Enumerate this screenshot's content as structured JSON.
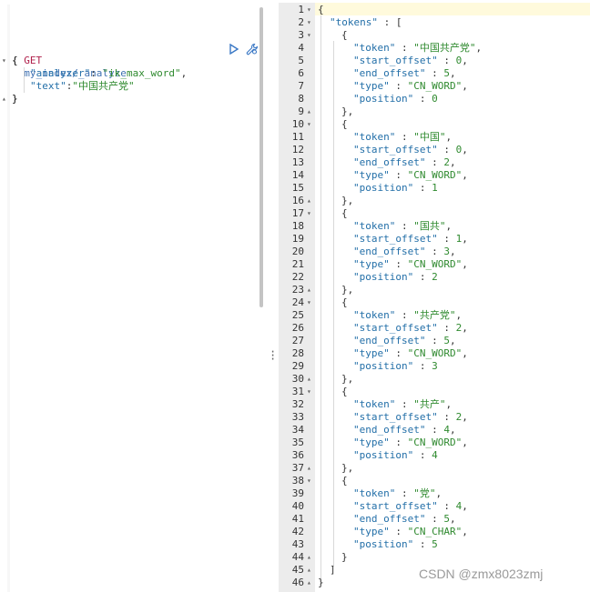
{
  "request": {
    "method": "GET",
    "path": "my_index/_analyze",
    "body": [
      {
        "fold": "▾",
        "text": "{"
      },
      {
        "fold": "",
        "parts": [
          {
            "t": "\"analyzer\"",
            "c": "key"
          },
          {
            "t": ": ",
            "c": "punc"
          },
          {
            "t": "\"ik_max_word\"",
            "c": "str"
          },
          {
            "t": ",",
            "c": "punc"
          }
        ]
      },
      {
        "fold": "",
        "parts": [
          {
            "t": "\"text\"",
            "c": "key"
          },
          {
            "t": ":",
            "c": "punc"
          },
          {
            "t": "\"中国共产党\"",
            "c": "str"
          }
        ]
      },
      {
        "fold": "▴",
        "text": "}"
      }
    ]
  },
  "response": {
    "lines": [
      {
        "n": "1",
        "f": "▾",
        "ind": 0,
        "parts": [
          {
            "t": "{",
            "c": "punc"
          }
        ]
      },
      {
        "n": "2",
        "f": "▾",
        "ind": 1,
        "parts": [
          {
            "t": "\"tokens\"",
            "c": "key"
          },
          {
            "t": " : [",
            "c": "punc"
          }
        ]
      },
      {
        "n": "3",
        "f": "▾",
        "ind": 2,
        "parts": [
          {
            "t": "{",
            "c": "punc"
          }
        ]
      },
      {
        "n": "4",
        "f": "",
        "ind": 3,
        "parts": [
          {
            "t": "\"token\"",
            "c": "key"
          },
          {
            "t": " : ",
            "c": "punc"
          },
          {
            "t": "\"中国共产党\"",
            "c": "str"
          },
          {
            "t": ",",
            "c": "punc"
          }
        ]
      },
      {
        "n": "5",
        "f": "",
        "ind": 3,
        "parts": [
          {
            "t": "\"start_offset\"",
            "c": "key"
          },
          {
            "t": " : ",
            "c": "punc"
          },
          {
            "t": "0",
            "c": "num"
          },
          {
            "t": ",",
            "c": "punc"
          }
        ]
      },
      {
        "n": "6",
        "f": "",
        "ind": 3,
        "parts": [
          {
            "t": "\"end_offset\"",
            "c": "key"
          },
          {
            "t": " : ",
            "c": "punc"
          },
          {
            "t": "5",
            "c": "num"
          },
          {
            "t": ",",
            "c": "punc"
          }
        ]
      },
      {
        "n": "7",
        "f": "",
        "ind": 3,
        "parts": [
          {
            "t": "\"type\"",
            "c": "key"
          },
          {
            "t": " : ",
            "c": "punc"
          },
          {
            "t": "\"CN_WORD\"",
            "c": "str"
          },
          {
            "t": ",",
            "c": "punc"
          }
        ]
      },
      {
        "n": "8",
        "f": "",
        "ind": 3,
        "parts": [
          {
            "t": "\"position\"",
            "c": "key"
          },
          {
            "t": " : ",
            "c": "punc"
          },
          {
            "t": "0",
            "c": "num"
          }
        ]
      },
      {
        "n": "9",
        "f": "▴",
        "ind": 2,
        "parts": [
          {
            "t": "},",
            "c": "punc"
          }
        ]
      },
      {
        "n": "10",
        "f": "▾",
        "ind": 2,
        "parts": [
          {
            "t": "{",
            "c": "punc"
          }
        ]
      },
      {
        "n": "11",
        "f": "",
        "ind": 3,
        "parts": [
          {
            "t": "\"token\"",
            "c": "key"
          },
          {
            "t": " : ",
            "c": "punc"
          },
          {
            "t": "\"中国\"",
            "c": "str"
          },
          {
            "t": ",",
            "c": "punc"
          }
        ]
      },
      {
        "n": "12",
        "f": "",
        "ind": 3,
        "parts": [
          {
            "t": "\"start_offset\"",
            "c": "key"
          },
          {
            "t": " : ",
            "c": "punc"
          },
          {
            "t": "0",
            "c": "num"
          },
          {
            "t": ",",
            "c": "punc"
          }
        ]
      },
      {
        "n": "13",
        "f": "",
        "ind": 3,
        "parts": [
          {
            "t": "\"end_offset\"",
            "c": "key"
          },
          {
            "t": " : ",
            "c": "punc"
          },
          {
            "t": "2",
            "c": "num"
          },
          {
            "t": ",",
            "c": "punc"
          }
        ]
      },
      {
        "n": "14",
        "f": "",
        "ind": 3,
        "parts": [
          {
            "t": "\"type\"",
            "c": "key"
          },
          {
            "t": " : ",
            "c": "punc"
          },
          {
            "t": "\"CN_WORD\"",
            "c": "str"
          },
          {
            "t": ",",
            "c": "punc"
          }
        ]
      },
      {
        "n": "15",
        "f": "",
        "ind": 3,
        "parts": [
          {
            "t": "\"position\"",
            "c": "key"
          },
          {
            "t": " : ",
            "c": "punc"
          },
          {
            "t": "1",
            "c": "num"
          }
        ]
      },
      {
        "n": "16",
        "f": "▴",
        "ind": 2,
        "parts": [
          {
            "t": "},",
            "c": "punc"
          }
        ]
      },
      {
        "n": "17",
        "f": "▾",
        "ind": 2,
        "parts": [
          {
            "t": "{",
            "c": "punc"
          }
        ]
      },
      {
        "n": "18",
        "f": "",
        "ind": 3,
        "parts": [
          {
            "t": "\"token\"",
            "c": "key"
          },
          {
            "t": " : ",
            "c": "punc"
          },
          {
            "t": "\"国共\"",
            "c": "str"
          },
          {
            "t": ",",
            "c": "punc"
          }
        ]
      },
      {
        "n": "19",
        "f": "",
        "ind": 3,
        "parts": [
          {
            "t": "\"start_offset\"",
            "c": "key"
          },
          {
            "t": " : ",
            "c": "punc"
          },
          {
            "t": "1",
            "c": "num"
          },
          {
            "t": ",",
            "c": "punc"
          }
        ]
      },
      {
        "n": "20",
        "f": "",
        "ind": 3,
        "parts": [
          {
            "t": "\"end_offset\"",
            "c": "key"
          },
          {
            "t": " : ",
            "c": "punc"
          },
          {
            "t": "3",
            "c": "num"
          },
          {
            "t": ",",
            "c": "punc"
          }
        ]
      },
      {
        "n": "21",
        "f": "",
        "ind": 3,
        "parts": [
          {
            "t": "\"type\"",
            "c": "key"
          },
          {
            "t": " : ",
            "c": "punc"
          },
          {
            "t": "\"CN_WORD\"",
            "c": "str"
          },
          {
            "t": ",",
            "c": "punc"
          }
        ]
      },
      {
        "n": "22",
        "f": "",
        "ind": 3,
        "parts": [
          {
            "t": "\"position\"",
            "c": "key"
          },
          {
            "t": " : ",
            "c": "punc"
          },
          {
            "t": "2",
            "c": "num"
          }
        ]
      },
      {
        "n": "23",
        "f": "▴",
        "ind": 2,
        "parts": [
          {
            "t": "},",
            "c": "punc"
          }
        ]
      },
      {
        "n": "24",
        "f": "▾",
        "ind": 2,
        "parts": [
          {
            "t": "{",
            "c": "punc"
          }
        ]
      },
      {
        "n": "25",
        "f": "",
        "ind": 3,
        "parts": [
          {
            "t": "\"token\"",
            "c": "key"
          },
          {
            "t": " : ",
            "c": "punc"
          },
          {
            "t": "\"共产党\"",
            "c": "str"
          },
          {
            "t": ",",
            "c": "punc"
          }
        ]
      },
      {
        "n": "26",
        "f": "",
        "ind": 3,
        "parts": [
          {
            "t": "\"start_offset\"",
            "c": "key"
          },
          {
            "t": " : ",
            "c": "punc"
          },
          {
            "t": "2",
            "c": "num"
          },
          {
            "t": ",",
            "c": "punc"
          }
        ]
      },
      {
        "n": "27",
        "f": "",
        "ind": 3,
        "parts": [
          {
            "t": "\"end_offset\"",
            "c": "key"
          },
          {
            "t": " : ",
            "c": "punc"
          },
          {
            "t": "5",
            "c": "num"
          },
          {
            "t": ",",
            "c": "punc"
          }
        ]
      },
      {
        "n": "28",
        "f": "",
        "ind": 3,
        "parts": [
          {
            "t": "\"type\"",
            "c": "key"
          },
          {
            "t": " : ",
            "c": "punc"
          },
          {
            "t": "\"CN_WORD\"",
            "c": "str"
          },
          {
            "t": ",",
            "c": "punc"
          }
        ]
      },
      {
        "n": "29",
        "f": "",
        "ind": 3,
        "parts": [
          {
            "t": "\"position\"",
            "c": "key"
          },
          {
            "t": " : ",
            "c": "punc"
          },
          {
            "t": "3",
            "c": "num"
          }
        ]
      },
      {
        "n": "30",
        "f": "▴",
        "ind": 2,
        "parts": [
          {
            "t": "},",
            "c": "punc"
          }
        ]
      },
      {
        "n": "31",
        "f": "▾",
        "ind": 2,
        "parts": [
          {
            "t": "{",
            "c": "punc"
          }
        ]
      },
      {
        "n": "32",
        "f": "",
        "ind": 3,
        "parts": [
          {
            "t": "\"token\"",
            "c": "key"
          },
          {
            "t": " : ",
            "c": "punc"
          },
          {
            "t": "\"共产\"",
            "c": "str"
          },
          {
            "t": ",",
            "c": "punc"
          }
        ]
      },
      {
        "n": "33",
        "f": "",
        "ind": 3,
        "parts": [
          {
            "t": "\"start_offset\"",
            "c": "key"
          },
          {
            "t": " : ",
            "c": "punc"
          },
          {
            "t": "2",
            "c": "num"
          },
          {
            "t": ",",
            "c": "punc"
          }
        ]
      },
      {
        "n": "34",
        "f": "",
        "ind": 3,
        "parts": [
          {
            "t": "\"end_offset\"",
            "c": "key"
          },
          {
            "t": " : ",
            "c": "punc"
          },
          {
            "t": "4",
            "c": "num"
          },
          {
            "t": ",",
            "c": "punc"
          }
        ]
      },
      {
        "n": "35",
        "f": "",
        "ind": 3,
        "parts": [
          {
            "t": "\"type\"",
            "c": "key"
          },
          {
            "t": " : ",
            "c": "punc"
          },
          {
            "t": "\"CN_WORD\"",
            "c": "str"
          },
          {
            "t": ",",
            "c": "punc"
          }
        ]
      },
      {
        "n": "36",
        "f": "",
        "ind": 3,
        "parts": [
          {
            "t": "\"position\"",
            "c": "key"
          },
          {
            "t": " : ",
            "c": "punc"
          },
          {
            "t": "4",
            "c": "num"
          }
        ]
      },
      {
        "n": "37",
        "f": "▴",
        "ind": 2,
        "parts": [
          {
            "t": "},",
            "c": "punc"
          }
        ]
      },
      {
        "n": "38",
        "f": "▾",
        "ind": 2,
        "parts": [
          {
            "t": "{",
            "c": "punc"
          }
        ]
      },
      {
        "n": "39",
        "f": "",
        "ind": 3,
        "parts": [
          {
            "t": "\"token\"",
            "c": "key"
          },
          {
            "t": " : ",
            "c": "punc"
          },
          {
            "t": "\"党\"",
            "c": "str"
          },
          {
            "t": ",",
            "c": "punc"
          }
        ]
      },
      {
        "n": "40",
        "f": "",
        "ind": 3,
        "parts": [
          {
            "t": "\"start_offset\"",
            "c": "key"
          },
          {
            "t": " : ",
            "c": "punc"
          },
          {
            "t": "4",
            "c": "num"
          },
          {
            "t": ",",
            "c": "punc"
          }
        ]
      },
      {
        "n": "41",
        "f": "",
        "ind": 3,
        "parts": [
          {
            "t": "\"end_offset\"",
            "c": "key"
          },
          {
            "t": " : ",
            "c": "punc"
          },
          {
            "t": "5",
            "c": "num"
          },
          {
            "t": ",",
            "c": "punc"
          }
        ]
      },
      {
        "n": "42",
        "f": "",
        "ind": 3,
        "parts": [
          {
            "t": "\"type\"",
            "c": "key"
          },
          {
            "t": " : ",
            "c": "punc"
          },
          {
            "t": "\"CN_CHAR\"",
            "c": "str"
          },
          {
            "t": ",",
            "c": "punc"
          }
        ]
      },
      {
        "n": "43",
        "f": "",
        "ind": 3,
        "parts": [
          {
            "t": "\"position\"",
            "c": "key"
          },
          {
            "t": " : ",
            "c": "punc"
          },
          {
            "t": "5",
            "c": "num"
          }
        ]
      },
      {
        "n": "44",
        "f": "▴",
        "ind": 2,
        "parts": [
          {
            "t": "}",
            "c": "punc"
          }
        ]
      },
      {
        "n": "45",
        "f": "▴",
        "ind": 1,
        "parts": [
          {
            "t": "]",
            "c": "punc"
          }
        ]
      },
      {
        "n": "46",
        "f": "▴",
        "ind": 0,
        "parts": [
          {
            "t": "}",
            "c": "punc"
          }
        ]
      }
    ]
  },
  "icons": {
    "run": "play-icon",
    "settings": "wrench-icon"
  },
  "watermark": "CSDN @zmx8023zmj",
  "colors": {
    "key": "#236fa8",
    "string": "#2f8a2f",
    "method": "#b01f4a",
    "path": "#3d70b2"
  }
}
